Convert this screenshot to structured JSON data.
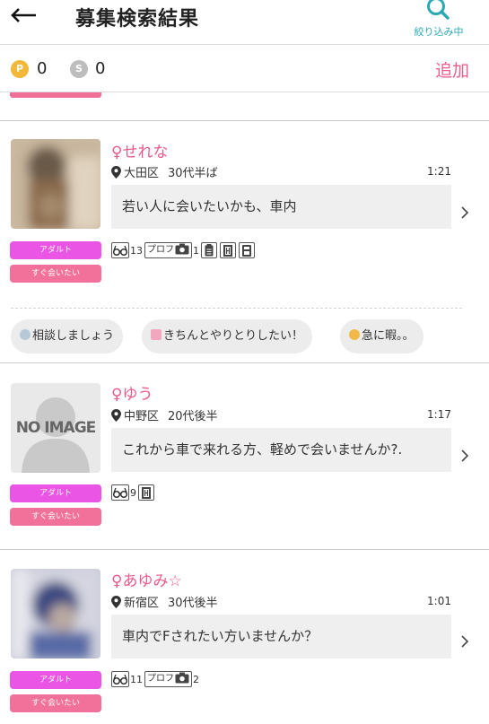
{
  "header": {
    "title": "募集検索結果",
    "filter_label": "絞り込み中"
  },
  "points": {
    "p_label": "P",
    "p_value": "0",
    "s_label": "S",
    "s_value": "0",
    "add_label": "追加"
  },
  "posts": [
    {
      "name": "♀せれな",
      "area": "大田区",
      "age": "30代半ば",
      "time": "1:21",
      "message": "若い人に会いたいかも、車内",
      "badges": [
        "アダルト",
        "すぐ会いたい"
      ],
      "stats": {
        "views": "13",
        "prof_label": "プロフ",
        "photos": "1"
      },
      "photo_blurred": true
    },
    {
      "name": "♀ゆう",
      "area": "中野区",
      "age": "20代後半",
      "time": "1:17",
      "message": "これから車で来れる方、軽めで会いませんか?.",
      "badges": [
        "アダルト",
        "すぐ会いたい"
      ],
      "stats": {
        "views": "9"
      },
      "no_image_text": "NO IMAGE"
    },
    {
      "name": "♀あゆみ☆",
      "area": "新宿区",
      "age": "30代後半",
      "time": "1:01",
      "message": "車内でFされたい方いませんか？",
      "badges": [
        "アダルト",
        "すぐ会いたい"
      ],
      "stats": {
        "views": "11",
        "prof_label": "プロフ",
        "photos": "2"
      },
      "photo_blurred": true
    }
  ],
  "chips": [
    "相談しましょう",
    "きちんとやりとりしたい！",
    "急に暇。。"
  ],
  "colors": {
    "accent_pink": "#ea5a88",
    "adult_badge": "#eb55e6",
    "soon_badge": "#f2719a",
    "filter_teal": "#2aa9b3"
  }
}
